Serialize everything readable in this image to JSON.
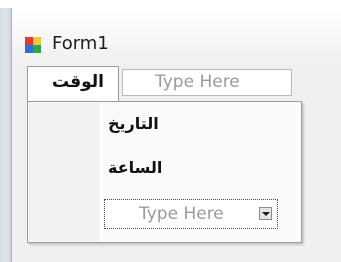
{
  "window": {
    "title": "Form1",
    "icon": "form-icon"
  },
  "menu": {
    "active_item_label": "الوقت",
    "new_item_placeholder": "Type Here"
  },
  "dropdown": {
    "items": [
      {
        "label": "التاريخ"
      },
      {
        "label": "الساعة"
      }
    ],
    "new_item_placeholder": "Type Here",
    "dropdown_arrow_icon": "chevron-down-icon"
  },
  "colors": {
    "client_background": "#f0f0f0",
    "placeholder_text": "#9a9a9a",
    "border": "#9b9b9b"
  }
}
